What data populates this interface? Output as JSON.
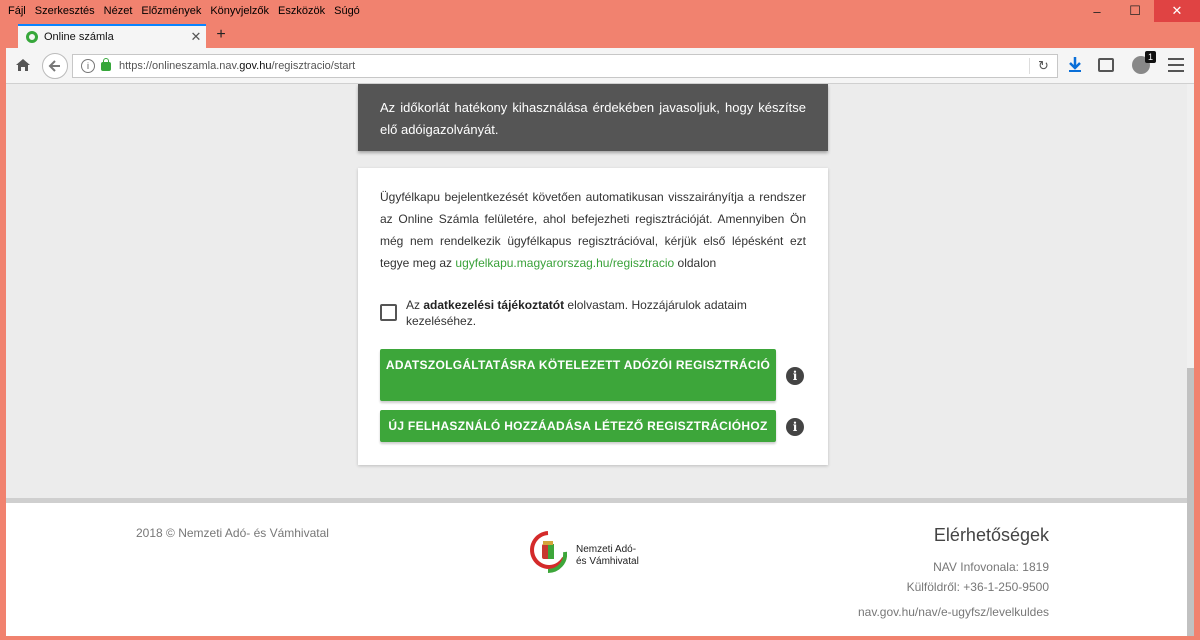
{
  "browser": {
    "menu": [
      "Fájl",
      "Szerkesztés",
      "Nézet",
      "Előzmények",
      "Könyvjelzők",
      "Eszközök",
      "Súgó"
    ],
    "window_controls": {
      "minimize": "–",
      "maximize": "☐",
      "close": "✕"
    },
    "tab_title": "Online számla",
    "tab_close": "✕",
    "new_tab": "+",
    "url_prefix": "https://onlineszamla.nav.",
    "url_domain": "gov.hu",
    "url_path": "/regisztracio/start",
    "extension_badge": "1",
    "icons": [
      "home-icon",
      "back-arrow-icon",
      "info-icon",
      "lock-icon",
      "reload-icon",
      "download-icon",
      "reader-view-icon",
      "extension-icon",
      "hamburger-menu-icon"
    ]
  },
  "notice": {
    "text": "Az időkorlát hatékony kihasználása érdekében javasoljuk, hogy készítse elő adóigazolványát."
  },
  "registration": {
    "intro_text": "Ügyfélkapu bejelentkezését követően automatikusan visszairányítja a rendszer az Online Számla felületére, ahol befejezheti regisztrációját. Amennyiben Ön még nem rendelkezik ügyfélkapus regisztrációval, kérjük első lépésként ezt tegye meg az",
    "link_text": "ugyfelkapu.magyarorszag.hu/regisztracio",
    "link_suffix": "oldalon",
    "consent_prefix": "Az",
    "consent_bold": "adatkezelési tájékoztatót",
    "consent_suffix": "elolvastam. Hozzájárulok adataim kezeléséhez.",
    "consent_checked": false,
    "button_primary": "ADATSZOLGÁLTATÁSRA KÖTELEZETT ADÓZÓI REGISZTRÁCIÓ",
    "button_secondary": "ÚJ FELHASZNÁLÓ HOZZÁADÁSA LÉTEZŐ REGISZTRÁCIÓHOZ",
    "info_glyph": "i",
    "accent_color": "#3da63a"
  },
  "footer": {
    "copyright": "2018 © Nemzeti Adó- és Vámhivatal",
    "logo_line1": "Nemzeti Adó-",
    "logo_line2": "és Vámhivatal",
    "contact_title": "Elérhetőségek",
    "infoline": "NAV Infovonala: 1819",
    "abroad": "Külföldről: +36-1-250-9500",
    "contact_link": "nav.gov.hu/nav/e-ugyfsz/levelkuldes"
  }
}
